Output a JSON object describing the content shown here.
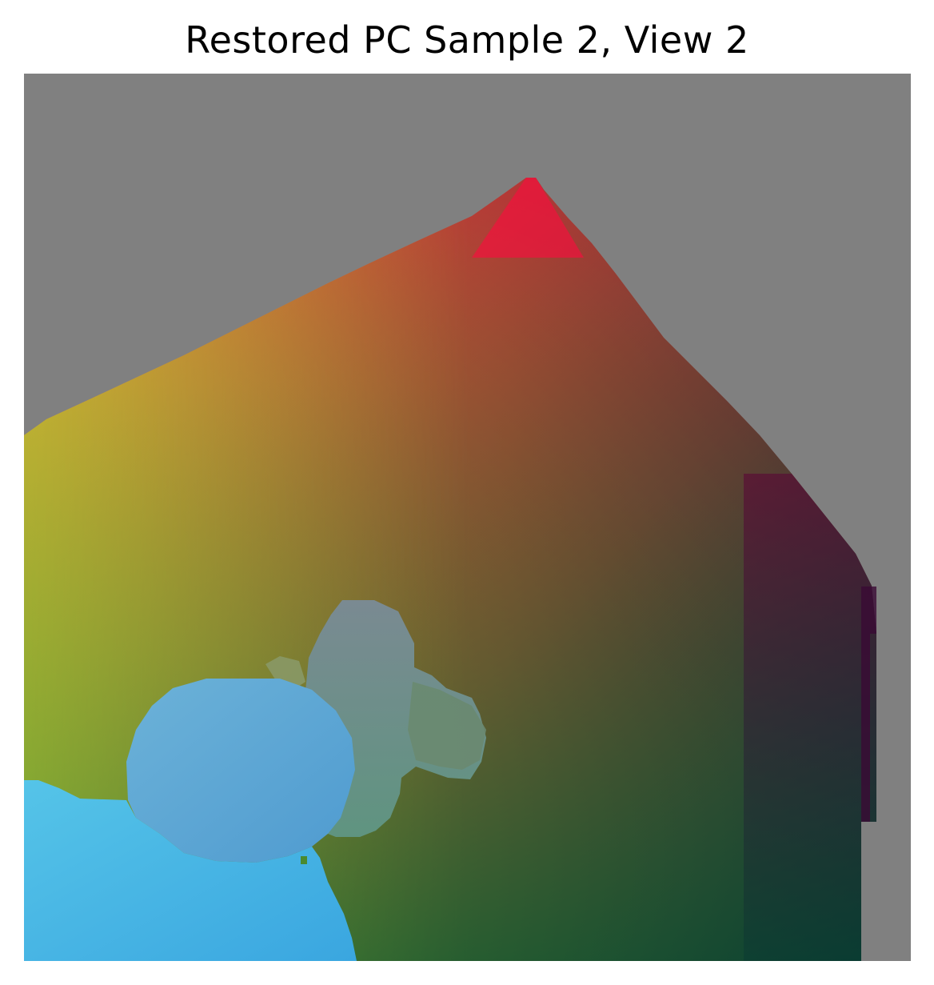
{
  "figure": {
    "title": "Restored PC Sample 2, View 2"
  },
  "image": {
    "description_tag": "point-cloud-normal-rendering",
    "background_color": "#808080",
    "colors": {
      "top_peak_red": "#ff0040",
      "left_orange": "#f8b43a",
      "left_yellow_green": "#9ed932",
      "bottom_green": "#45a030",
      "bottom_right_dark_green": "#0a3f31",
      "right_dark_purple": "#4a0034",
      "center_brown": "#7a5a35",
      "blob_blue": "#5fa6dc",
      "bottom_left_cyan": "#4ec7ea",
      "gray_blue_shape": "#7a8a8a",
      "teal_shape": "#5e8e7a"
    }
  }
}
